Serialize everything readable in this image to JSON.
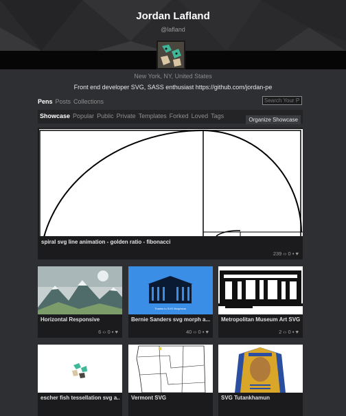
{
  "profile": {
    "name": "Jordan Lafland",
    "handle": "@lafland",
    "location": "New York, NY, United States",
    "bio": "Front end developer SVG, SASS enthusiast https://github.com/jordan-pe"
  },
  "nav": {
    "items": [
      "Pens",
      "Posts",
      "Collections"
    ],
    "active": "Pens"
  },
  "search": {
    "placeholder": "Search Your P"
  },
  "tabs": {
    "items": [
      "Showcase",
      "Popular",
      "Public",
      "Private",
      "Templates",
      "Forked",
      "Loved",
      "Tags"
    ],
    "active": "Showcase",
    "organize_label": "Organize Showcase"
  },
  "featured": {
    "title": "spiral svg line animation - golden ratio - fibonacci",
    "views": "239",
    "comments": "0",
    "hearts": ""
  },
  "pens": [
    {
      "title": "Horizontal Responsive",
      "views": "6",
      "comments": "0",
      "hearts": ""
    },
    {
      "title": "Bernie Sanders svg morph a...",
      "views": "40",
      "comments": "0",
      "hearts": ""
    },
    {
      "title": "Metropolitan Museum Art SVG",
      "views": "2",
      "comments": "0",
      "hearts": ""
    },
    {
      "title": "escher fish tessellation svg a...",
      "views": "",
      "comments": "",
      "hearts": ""
    },
    {
      "title": "Vermont SVG",
      "views": "",
      "comments": "",
      "hearts": ""
    },
    {
      "title": "SVG Tutankhamun",
      "views": "",
      "comments": "",
      "hearts": ""
    }
  ],
  "thumb_text": {
    "bernie": "Thanks to SVG Morpheus"
  },
  "icons": {
    "views": "code-eye-icon",
    "comments": "comment-icon",
    "hearts": "heart-icon"
  },
  "colors": {
    "background": "#2e2f33",
    "card": "#1b1b1d",
    "bernie_blue": "#3a8ee6"
  }
}
